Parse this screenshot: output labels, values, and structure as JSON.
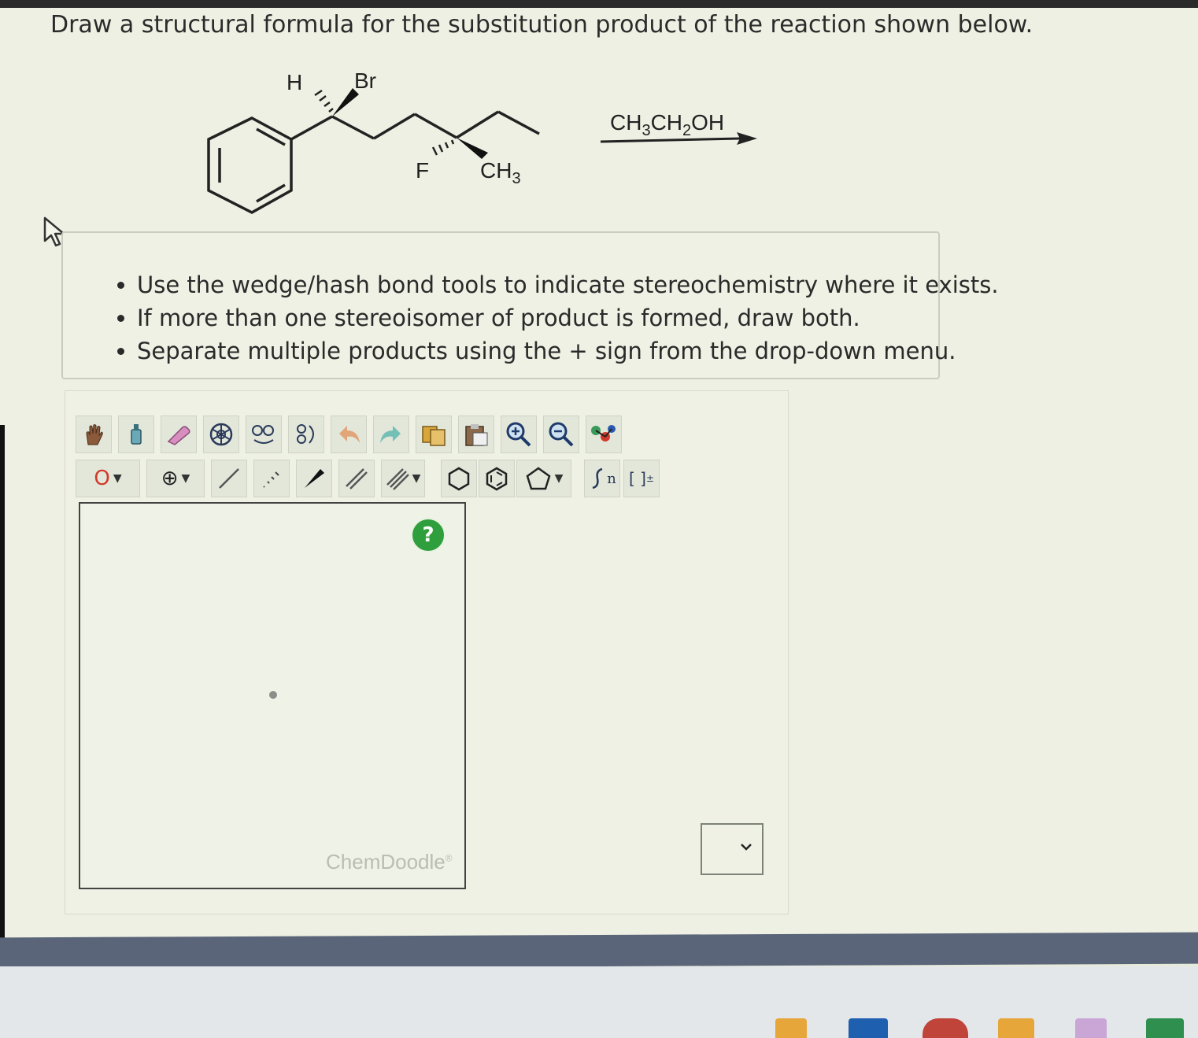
{
  "question": {
    "text": "Draw a structural formula for the substitution product of the reaction shown below."
  },
  "reaction": {
    "labels": {
      "h": "H",
      "br": "Br",
      "f": "F",
      "ch3": "CH",
      "ch3_sub": "3",
      "reagent_a": "CH",
      "reagent_a_sub": "3",
      "reagent_b": "CH",
      "reagent_b_sub": "2",
      "reagent_c": "OH"
    }
  },
  "instructions": {
    "items": [
      "Use the wedge/hash bond tools to indicate stereochemistry where it exists.",
      "If more than one stereoisomer of product is formed, draw both.",
      "Separate multiple products using the + sign from the drop-down menu."
    ]
  },
  "toolbar": {
    "atom_label": "O",
    "charge_label": "⊕",
    "bracket_label": "[ ]",
    "bracket_sup": "±",
    "sgroup_label": "n"
  },
  "canvas": {
    "help_label": "?",
    "brand": "ChemDoodle",
    "brand_mark": "®"
  },
  "colors": {
    "help_green": "#2f9e3c",
    "undo_orange": "#e07a3a",
    "redo_teal": "#2aa7a0",
    "atom_red": "#d03a2a"
  }
}
